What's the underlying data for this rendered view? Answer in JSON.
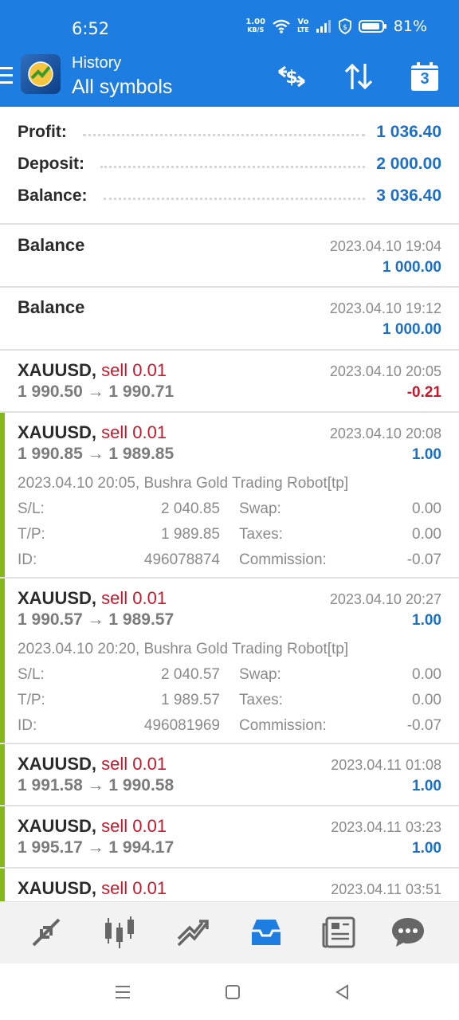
{
  "status": {
    "time": "6:52",
    "netspeed_top": "1.00",
    "netspeed_bottom": "KB/S",
    "volte_top": "Vo",
    "volte_bottom": "LTE",
    "battery": "81%"
  },
  "appbar": {
    "title": "History",
    "subtitle": "All symbols",
    "calendar_day": "3"
  },
  "summary": [
    {
      "label": "Profit:",
      "value": "1 036.40"
    },
    {
      "label": "Deposit:",
      "value": "2 000.00"
    },
    {
      "label": "Balance:",
      "value": "3 036.40"
    }
  ],
  "deals": [
    {
      "title": "Balance",
      "date": "2023.04.10 19:04",
      "amount": "1 000.00"
    },
    {
      "title": "Balance",
      "date": "2023.04.10 19:12",
      "amount": "1 000.00"
    },
    {
      "symbol": "XAUUSD,",
      "side": "sell 0.01",
      "prices": "1 990.50 → 1 990.71",
      "date": "2023.04.10 20:05",
      "amount": "-0.21"
    },
    {
      "symbol": "XAUUSD,",
      "side": "sell 0.01",
      "prices": "1 990.85 → 1 989.85",
      "date": "2023.04.10 20:08",
      "amount": "1.00",
      "comment": "2023.04.10 20:05, Bushra Gold Trading Robot[tp]",
      "sl_label": "S/L:",
      "sl": "2 040.85",
      "swap_label": "Swap:",
      "swap": "0.00",
      "tp_label": "T/P:",
      "tp": "1 989.85",
      "taxes_label": "Taxes:",
      "taxes": "0.00",
      "id_label": "ID:",
      "id": "496078874",
      "commission_label": "Commission:",
      "commission": "-0.07"
    },
    {
      "symbol": "XAUUSD,",
      "side": "sell 0.01",
      "prices": "1 990.57 → 1 989.57",
      "date": "2023.04.10 20:27",
      "amount": "1.00",
      "comment": "2023.04.10 20:20, Bushra Gold Trading Robot[tp]",
      "sl_label": "S/L:",
      "sl": "2 040.57",
      "swap_label": "Swap:",
      "swap": "0.00",
      "tp_label": "T/P:",
      "tp": "1 989.57",
      "taxes_label": "Taxes:",
      "taxes": "0.00",
      "id_label": "ID:",
      "id": "496081969",
      "commission_label": "Commission:",
      "commission": "-0.07"
    },
    {
      "symbol": "XAUUSD,",
      "side": "sell 0.01",
      "prices": "1 991.58 → 1 990.58",
      "date": "2023.04.11 01:08",
      "amount": "1.00"
    },
    {
      "symbol": "XAUUSD,",
      "side": "sell 0.01",
      "prices": "1 995.17 → 1 994.17",
      "date": "2023.04.11 03:23",
      "amount": "1.00"
    },
    {
      "symbol": "XAUUSD,",
      "side": "sell 0.01",
      "date": "2023.04.11 03:51"
    }
  ],
  "colors": {
    "accent": "#1e7de0",
    "profit": "#1c6fc9",
    "loss": "#c7182b",
    "win_bar": "#84b719"
  },
  "icons": {
    "appbar": [
      "menu-icon",
      "app-logo-icon",
      "currency-exchange-icon",
      "sort-icon",
      "calendar-icon"
    ],
    "bottom_nav": [
      "quotes-icon",
      "chart-icon",
      "trade-icon",
      "history-icon",
      "news-icon",
      "chat-icon"
    ],
    "system_nav": [
      "recents-icon",
      "home-icon",
      "back-icon"
    ]
  }
}
